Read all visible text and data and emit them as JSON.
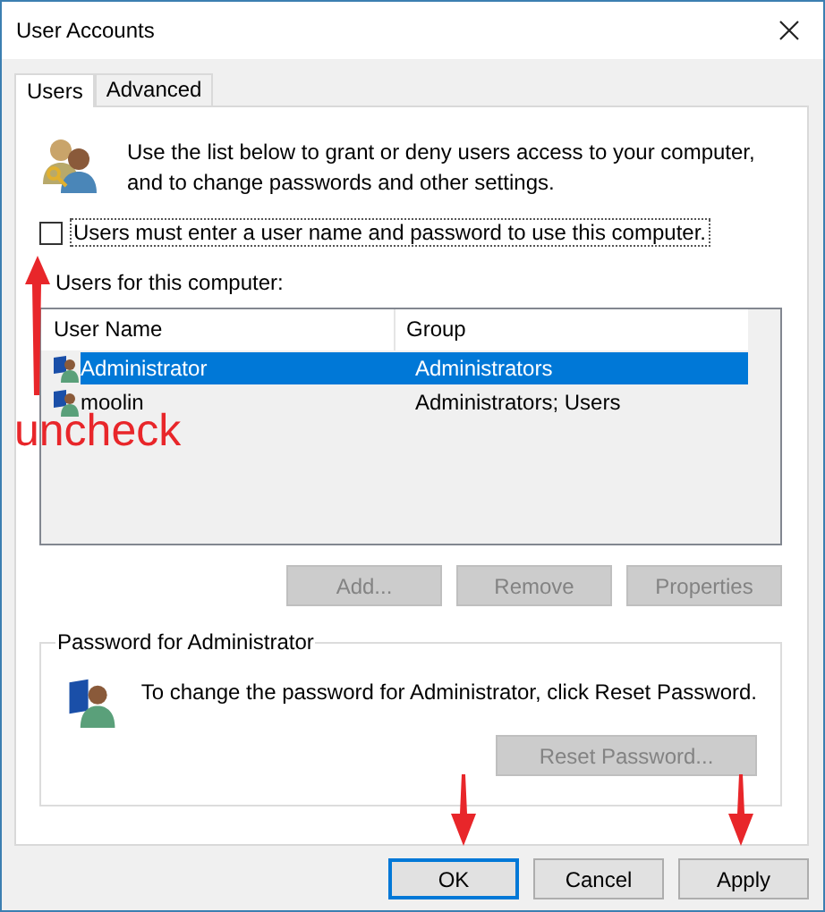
{
  "window": {
    "title": "User Accounts"
  },
  "tabs": [
    {
      "label": "Users",
      "selected": true
    },
    {
      "label": "Advanced",
      "selected": false
    }
  ],
  "intro": "Use the list below to grant or deny users access to your computer,\nand to change passwords and other settings.",
  "login_required": {
    "label": "Users must enter a user name and password to use this computer.",
    "checked": false
  },
  "users_label": "Users for this computer:",
  "columns": [
    "User Name",
    "Group"
  ],
  "rows": [
    {
      "name": "Administrator",
      "group": "Administrators",
      "selected": true
    },
    {
      "name": "moolin",
      "group": "Administrators; Users",
      "selected": false
    }
  ],
  "list_buttons": [
    {
      "label": "Add...",
      "disabled": true
    },
    {
      "label": "Remove",
      "disabled": true
    },
    {
      "label": "Properties",
      "disabled": true
    }
  ],
  "password_group": {
    "title": "Password for Administrator",
    "text": "To change the password for Administrator, click Reset Password.",
    "button": {
      "label": "Reset Password...",
      "disabled": true
    }
  },
  "dialog_buttons": [
    {
      "label": "OK",
      "default": true
    },
    {
      "label": "Cancel",
      "default": false
    },
    {
      "label": "Apply",
      "default": false
    }
  ],
  "annotation": {
    "label": "uncheck"
  }
}
